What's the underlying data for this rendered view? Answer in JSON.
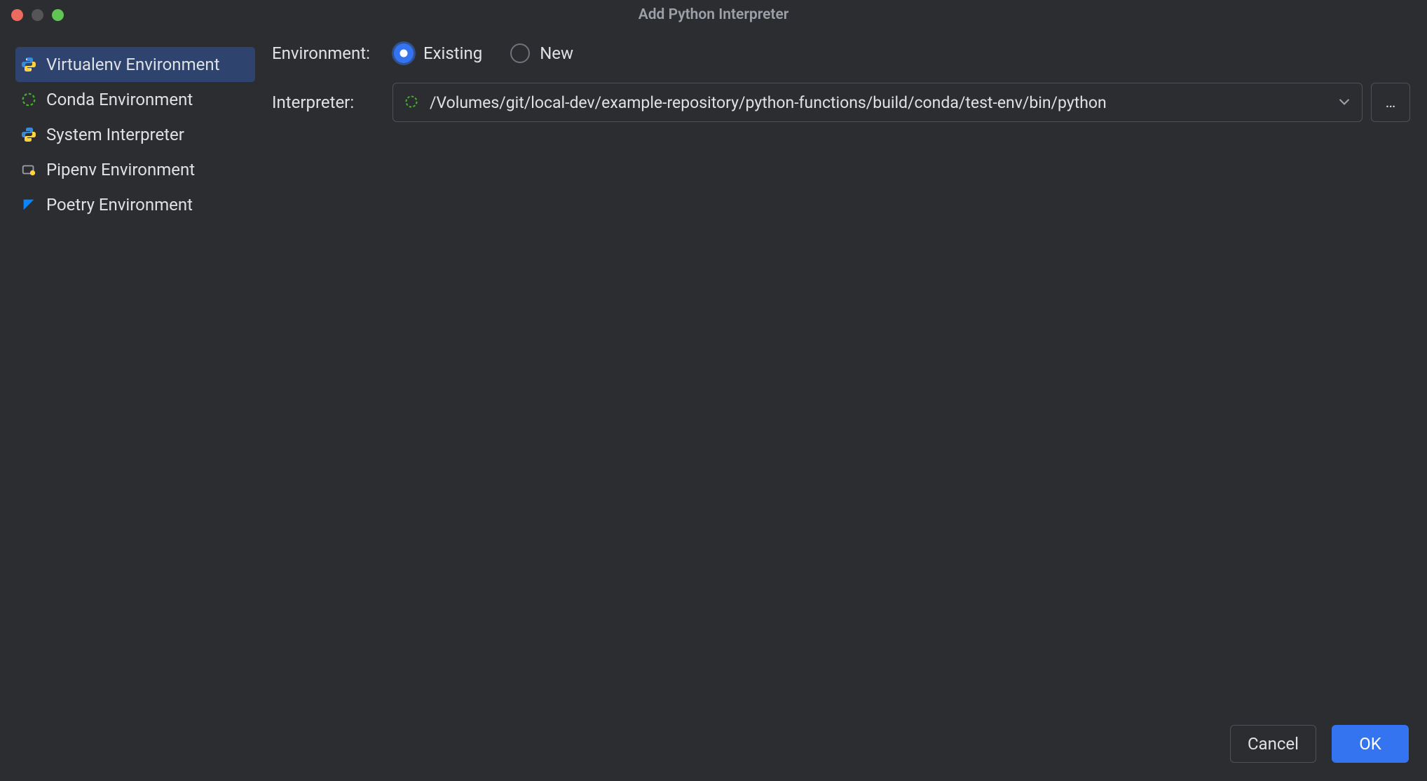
{
  "title": "Add Python Interpreter",
  "sidebar": {
    "items": [
      {
        "label": "Virtualenv Environment",
        "icon": "python-venv-icon"
      },
      {
        "label": "Conda Environment",
        "icon": "conda-icon"
      },
      {
        "label": "System Interpreter",
        "icon": "python-icon"
      },
      {
        "label": "Pipenv Environment",
        "icon": "pipenv-icon"
      },
      {
        "label": "Poetry Environment",
        "icon": "poetry-icon"
      }
    ],
    "selected_index": 0
  },
  "form": {
    "env_label": "Environment:",
    "radio_existing": "Existing",
    "radio_new": "New",
    "radio_selected": "existing",
    "interp_label": "Interpreter:",
    "interp_path": "/Volumes/git/local-dev/example-repository/python-functions/build/conda/test-env/bin/python",
    "browse_glyph": "…"
  },
  "buttons": {
    "cancel": "Cancel",
    "ok": "OK"
  }
}
